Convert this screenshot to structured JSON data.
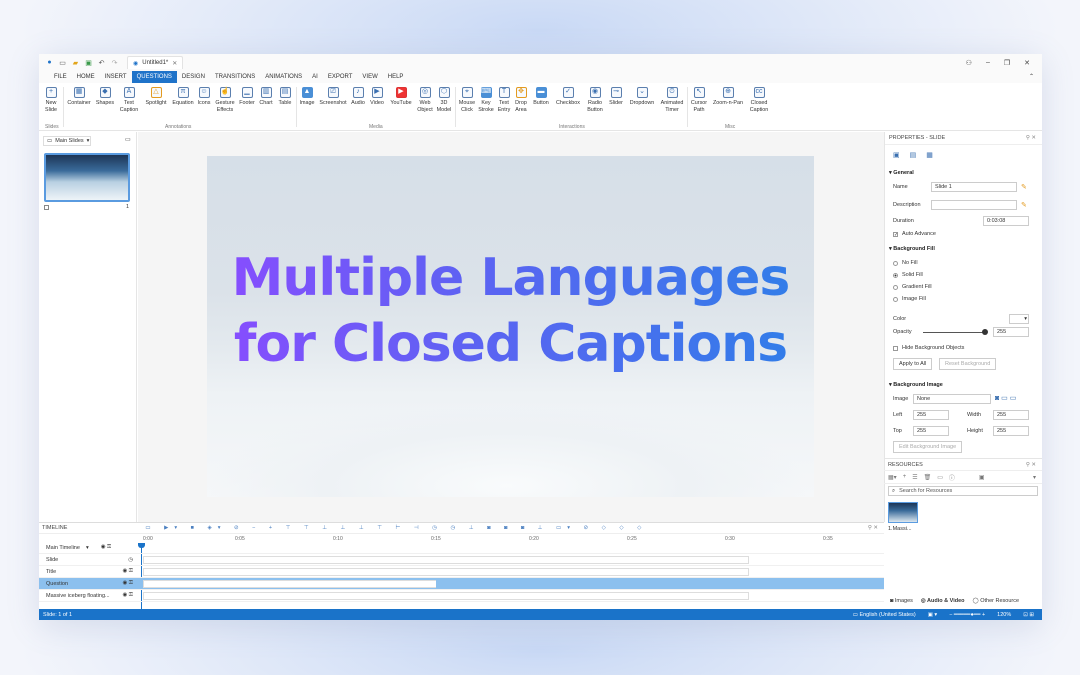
{
  "window": {
    "doc_tab": "Untitled1*"
  },
  "menu": [
    "FILE",
    "HOME",
    "INSERT",
    "QUESTIONS",
    "DESIGN",
    "TRANSITIONS",
    "ANIMATIONS",
    "AI",
    "EXPORT",
    "VIEW",
    "HELP"
  ],
  "menu_active_index": 3,
  "ribbon": {
    "buttons": [
      "New Slide",
      "Container",
      "Shapes",
      "Text Caption",
      "Spotlight",
      "Equation",
      "Icons",
      "Gesture Effects",
      "Footer",
      "Chart",
      "Table",
      "Image",
      "Screenshot",
      "Audio",
      "Video",
      "YouTube",
      "Web Object",
      "3D Model",
      "Mouse Click",
      "Key Stroke",
      "Text Entry",
      "Drop Area",
      "Button",
      "Checkbox",
      "Radio Button",
      "Slider",
      "Dropdown",
      "Animated Timer",
      "Cursor Path",
      "Zoom-n-Pan",
      "Closed Caption"
    ],
    "groups": [
      "Slides",
      "Annotations",
      "Media",
      "Interactions",
      "Misc"
    ]
  },
  "left_panel": {
    "dropdown": "Main Slides",
    "slide_number": "1"
  },
  "slide": {
    "line1": "Multiple Languages",
    "line2": "for Closed Captions"
  },
  "properties": {
    "title": "PROPERTIES - SLIDE",
    "general": "General",
    "name_label": "Name",
    "name_value": "Slide 1",
    "description_label": "Description",
    "duration_label": "Duration",
    "duration_value": "0:03:08",
    "auto_advance": "Auto Advance",
    "bg_fill": "Background Fill",
    "fill_options": [
      "No Fill",
      "Solid Fill",
      "Gradient Fill",
      "Image Fill"
    ],
    "color_label": "Color",
    "opacity_label": "Opacity",
    "opacity_value": "255",
    "hide_bg_objects": "Hide Background Objects",
    "apply_all": "Apply to All",
    "reset_bg": "Reset Background",
    "bg_image": "Background Image",
    "image_label": "Image",
    "image_value": "None",
    "left_label": "Left",
    "left_value": "255",
    "width_label": "Width",
    "width_value": "255",
    "top_label": "Top",
    "top_value": "255",
    "height_label": "Height",
    "height_value": "255",
    "edit_bg_image": "Edit Background Image"
  },
  "resources": {
    "title": "RESOURCES",
    "search_placeholder": "Search for Resources",
    "item_label": "1.Massi...",
    "tabs": [
      "Images",
      "Audio & Video",
      "Other Resource"
    ]
  },
  "timeline": {
    "title": "TIMELINE",
    "ruler": [
      "0:00",
      "0:05",
      "0:10",
      "0:15",
      "0:20",
      "0:25",
      "0:30",
      "0:35"
    ],
    "rows": [
      "Main Timeline",
      "Slide",
      "Title",
      "Question",
      "Massive iceberg floating..."
    ]
  },
  "status": {
    "left": "Slide: 1 of 1",
    "language": "English (United States)",
    "zoom": "120%"
  }
}
